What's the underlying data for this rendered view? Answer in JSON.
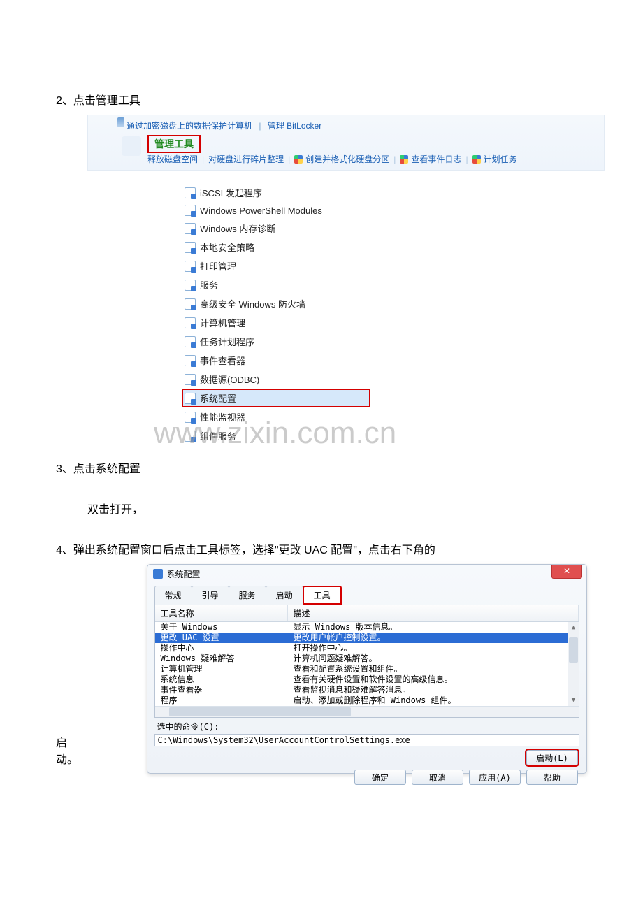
{
  "steps": {
    "s2": "2、点击管理工具",
    "s3": "3、点击系统配置",
    "s3b": "双击打开，",
    "s4": "4、弹出系统配置窗口后点击工具标签，选择\"更改 UAC 配置\"，点击右下角的",
    "s4tail": "启动。"
  },
  "shot1": {
    "line1a": "通过加密磁盘上的数据保护计算机",
    "line1b": "管理 BitLocker",
    "admin": "管理工具",
    "l3a": "释放磁盘空间",
    "l3b": "对硬盘进行碎片整理",
    "l3c": "创建并格式化硬盘分区",
    "l3d": "查看事件日志",
    "l3e": "计划任务"
  },
  "tools": {
    "items": [
      "iSCSI 发起程序",
      "Windows PowerShell Modules",
      "Windows 内存诊断",
      "本地安全策略",
      "打印管理",
      "服务",
      "高级安全 Windows 防火墙",
      "计算机管理",
      "任务计划程序",
      "事件查看器",
      "数据源(ODBC)",
      "系统配置",
      "性能监视器",
      "组件服务"
    ],
    "selectedIndex": 11
  },
  "watermark": "www.zixin.com.cn",
  "msconfig": {
    "title": "系统配置",
    "close": "✕",
    "tabs": [
      "常规",
      "引导",
      "服务",
      "启动",
      "工具"
    ],
    "activeTab": 4,
    "col_name": "工具名称",
    "col_desc": "描述",
    "rows": [
      {
        "n": "关于 Windows",
        "d": "显示 Windows 版本信息。"
      },
      {
        "n": "更改 UAC 设置",
        "d": "更改用户帐户控制设置。"
      },
      {
        "n": "操作中心",
        "d": "打开操作中心。"
      },
      {
        "n": "Windows 疑难解答",
        "d": "计算机问题疑难解答。"
      },
      {
        "n": "计算机管理",
        "d": "查看和配置系统设置和组件。"
      },
      {
        "n": "系统信息",
        "d": "查看有关硬件设置和软件设置的高级信息。"
      },
      {
        "n": "事件查看器",
        "d": "查看监视消息和疑难解答消息。"
      },
      {
        "n": "程序",
        "d": "启动、添加或删除程序和 Windows 组件。"
      }
    ],
    "selectedRow": 1,
    "cmd_label": "选中的命令(C):",
    "cmd_value": "C:\\Windows\\System32\\UserAccountControlSettings.exe",
    "btn_launch": "启动(L)",
    "btn_ok": "确定",
    "btn_cancel": "取消",
    "btn_apply": "应用(A)",
    "btn_help": "帮助"
  }
}
